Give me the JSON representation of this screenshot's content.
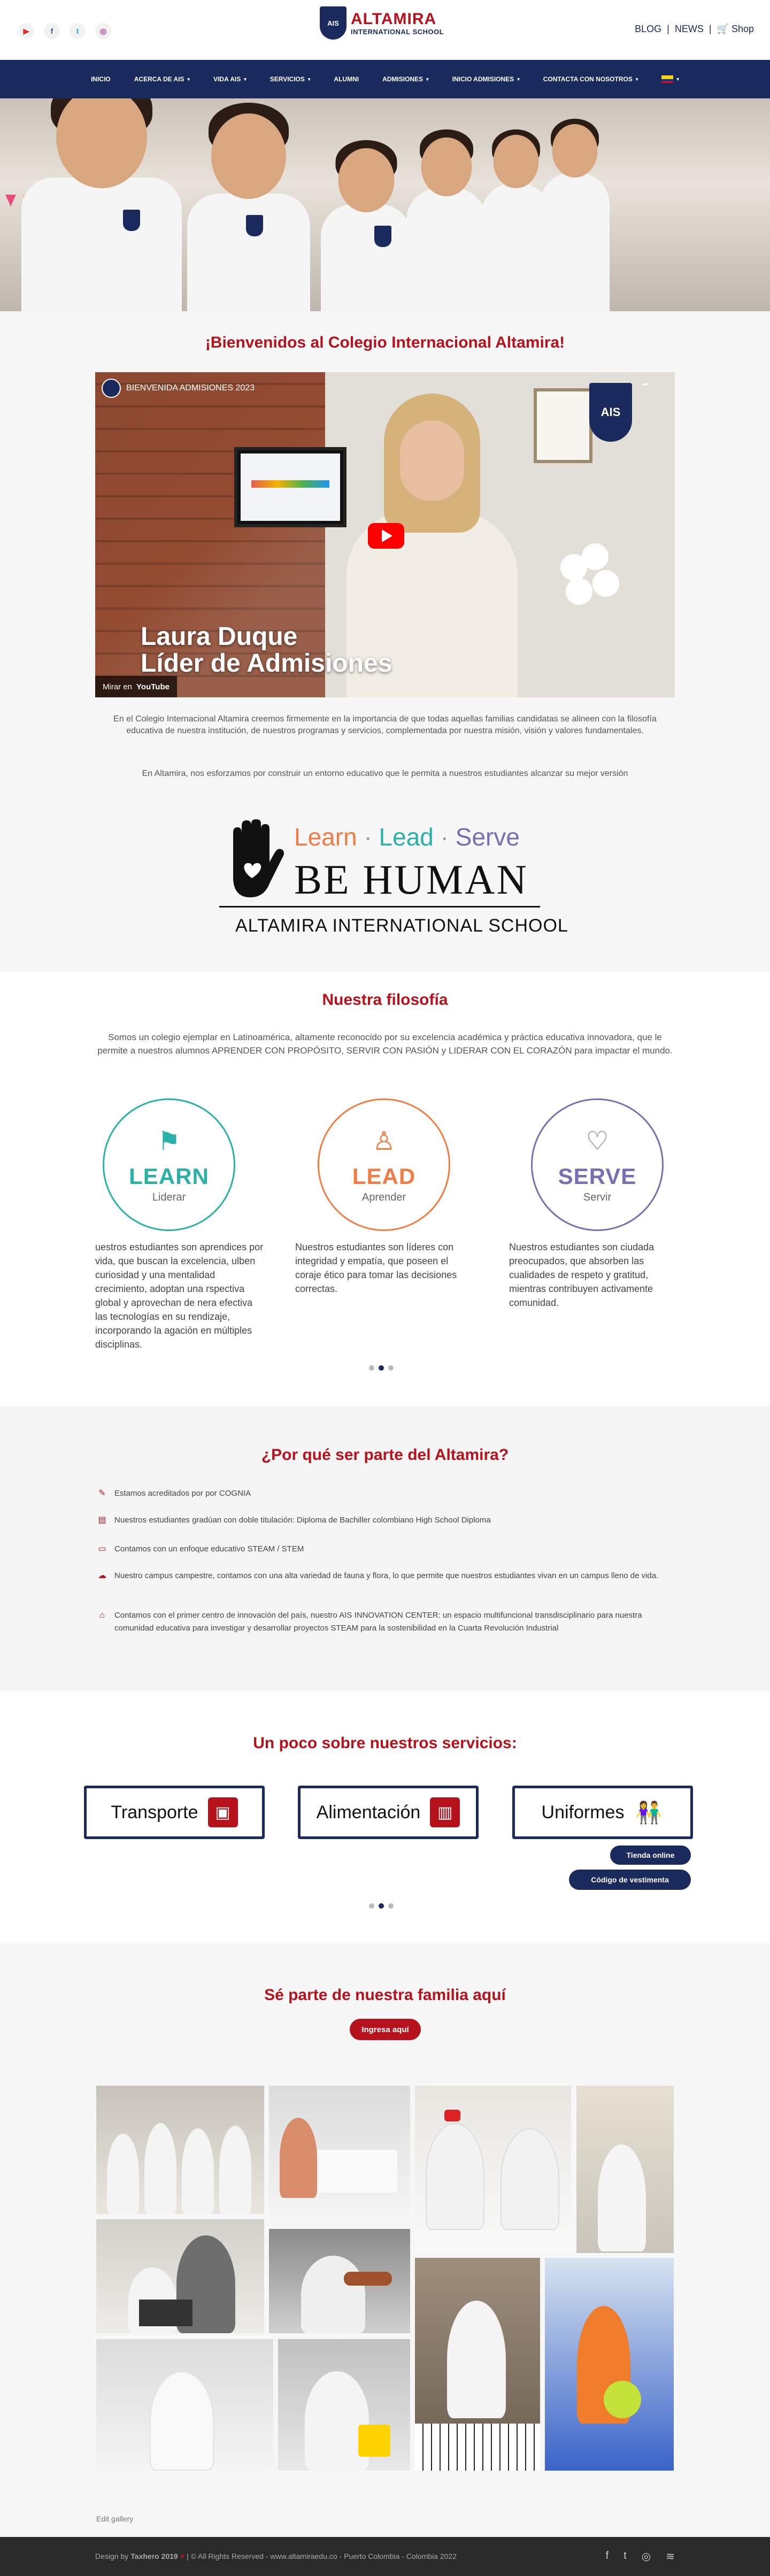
{
  "header": {
    "socials": [
      "youtube-icon",
      "facebook-icon",
      "twitter-icon",
      "instagram-icon"
    ],
    "logo_main": "ALTAMIRA",
    "logo_sub": "INTERNATIONAL SCHOOL",
    "logo_shield": "AIS",
    "links": {
      "blog": "BLOG",
      "sep1": "|",
      "news": "NEWS",
      "sep2": "|",
      "shop": "Shop"
    }
  },
  "nav": {
    "items": [
      {
        "label": "INICIO",
        "caret": false
      },
      {
        "label": "ACERCA DE AIS",
        "caret": true
      },
      {
        "label": "VIDA AIS",
        "caret": true
      },
      {
        "label": "SERVICIOS",
        "caret": true
      },
      {
        "label": "ALUMNI",
        "caret": false
      },
      {
        "label": "ADMISIONES",
        "caret": true
      },
      {
        "label": "INICIO ADMISIONES",
        "caret": true
      },
      {
        "label": "CONTACTA CON NOSOTROS",
        "caret": true
      }
    ],
    "caret": "▾",
    "language_caret": "▾"
  },
  "welcome": {
    "title": "¡Bienvenidos al Colegio Internacional Altamira!",
    "video": {
      "title": "BIENVENIDA ADMISIONES 2023",
      "share": "Compartir",
      "logo": "AIS",
      "overlay_line1": "Laura Duque",
      "overlay_line2": "Líder de Admisiones",
      "watch_on": "Mirar en",
      "youtube": "YouTube"
    },
    "para1": "En el Colegio Internacional Altamira creemos firmemente en la importancia de que todas aquellas familias candidatas se alineen con la filosofía educativa de nuestra institución, de nuestros programas y servicios, complementada por nuestra misión, visión y valores fundamentales.",
    "para2": "En Altamira, nos esforzamos por construir un entorno educativo que le permita a nuestros estudiantes alcanzar su mejor versión",
    "banner": {
      "learn": "Learn",
      "dot": "·",
      "lead": "Lead",
      "serve": "Serve",
      "be_human": "BE HUMAN",
      "school": "ALTAMIRA INTERNATIONAL SCHOOL"
    }
  },
  "philosophy": {
    "title": "Nuestra filosofía",
    "intro": "Somos un colegio ejemplar en Latinoamérica, altamente reconocido por su excelencia académica y práctica educativa innovadora, que le permite a nuestros alumnos APRENDER CON PROPÓSITO, SERVIR CON PASIÓN y LIDERAR CON EL CORAZÓN para impactar el mundo.",
    "pillars": [
      {
        "word": "LEARN",
        "sub": "Liderar",
        "color": "#2ab0a6",
        "icon": "flag-icon",
        "glyph": "⚑"
      },
      {
        "word": "LEAD",
        "sub": "Aprender",
        "color": "#ef7d45",
        "icon": "person-icon",
        "glyph": "♙"
      },
      {
        "word": "SERVE",
        "sub": "Servir",
        "color": "#7b6db3",
        "icon": "helping-hand-icon",
        "glyph": "♡"
      }
    ],
    "texts": [
      "uestros estudiantes son aprendices por vida, que buscan la excelencia, ulben curiosidad y una mentalidad crecimiento, adoptan una rspectiva global y aprovechan de nera efectiva las tecnologías en su rendizaje, incorporando la agación en múltiples disciplinas.",
      "Nuestros estudiantes son líderes con integridad y empatía, que poseen el coraje ético para tomar las decisiones correctas.",
      "Nuestros estudiantes son ciudada preocupados, que absorben las cualidades de respeto y gratitud, mientras contribuyen activamente comunidad."
    ]
  },
  "why": {
    "title": "¿Por qué ser parte del Altamira?",
    "items": [
      {
        "icon": "accreditation-icon",
        "glyph": "✎",
        "text": "Estamos acreditados por por COGNIA"
      },
      {
        "icon": "diploma-icon",
        "glyph": "▤",
        "text": "Nuestros estudiantes gradúan con doble titulación: Diploma de Bachiller colombiano High School Diploma"
      },
      {
        "icon": "monitor-icon",
        "glyph": "▭",
        "text": "Contamos con un enfoque educativo STEAM / STEM"
      },
      {
        "icon": "campus-icon",
        "glyph": "☁",
        "text": "Nuestro campus campestre, contamos con una alta variedad de fauna y flora, lo que permite que nuestros estudiantes vivan en un campus lleno de vida."
      },
      {
        "icon": "innovation-icon",
        "glyph": "⌂",
        "text": "Contamos con el primer centro de innovación del país, nuestro AIS INNOVATION CENTER: un espacio multifuncional transdisciplinario para nuestra comunidad educativa para investigar y desarrollar proyectos STEAM para la sostenibilidad en la Cuarta Revolución Industrial"
      }
    ]
  },
  "services": {
    "title": "Un poco sobre nuestros servicios:",
    "boxes": [
      {
        "label": "Transporte",
        "icon": "bus-icon",
        "glyph": "▣"
      },
      {
        "label": "Alimentación",
        "icon": "fridge-icon",
        "glyph": "▥"
      },
      {
        "label": "Uniformes",
        "icon": "uniform-icon",
        "glyph": "👫"
      }
    ],
    "shop_button": "Tienda online",
    "dress_button": "Código de vestimenta"
  },
  "family": {
    "title": "Sé parte de nuestra familia aquí",
    "button": "Ingresa aquí",
    "edit": "Edit gallery"
  },
  "footer": {
    "copy_prefix": "Design by",
    "designer": "Taxhero 2019",
    "copy_suffix": "| © All Rights Reserved - www.altamiraedu.co - Puerto Colombia - Colombia 2022",
    "socials": [
      "facebook-icon",
      "twitter-icon",
      "instagram-icon",
      "rss-icon"
    ]
  },
  "colors": {
    "brand_red": "#b5121b",
    "brand_navy": "#1b2a5c"
  }
}
